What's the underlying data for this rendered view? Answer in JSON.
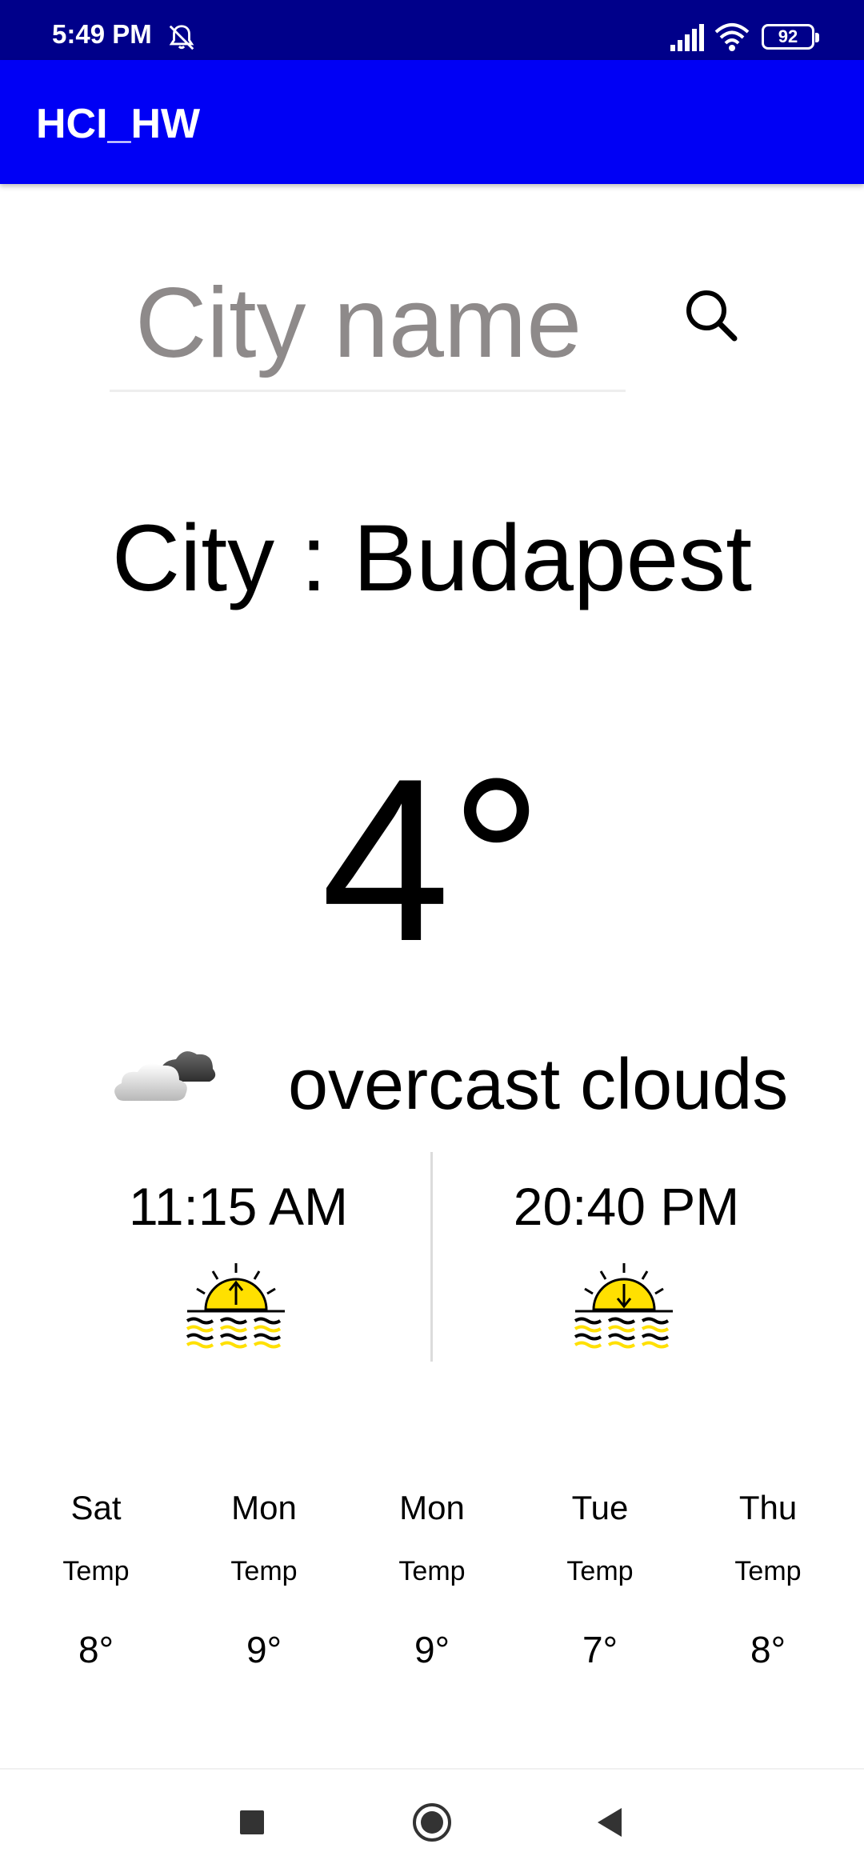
{
  "status_bar": {
    "time": "5:49 PM",
    "battery": "92",
    "bell_icon": "bell-muted-icon",
    "signal_icon": "signal-icon",
    "wifi_icon": "wifi-icon"
  },
  "app_bar": {
    "title": "HCI_HW",
    "color": "#0000f5"
  },
  "search": {
    "placeholder": "City name",
    "value": "",
    "icon": "search-icon"
  },
  "city": {
    "label": "City : Budapest"
  },
  "current": {
    "temperature": "4°",
    "description": "overcast clouds",
    "icon": "cloud-icon"
  },
  "sun": {
    "sunrise_time": "11:15 AM",
    "sunset_time": "20:40 PM",
    "sunrise_icon": "sunrise-icon",
    "sunset_icon": "sunset-icon",
    "sun_color": "#ffe000"
  },
  "forecast": [
    {
      "day": "Sat",
      "label": "Temp",
      "temp": "8°"
    },
    {
      "day": "Mon",
      "label": "Temp",
      "temp": "9°"
    },
    {
      "day": "Mon",
      "label": "Temp",
      "temp": "9°"
    },
    {
      "day": "Tue",
      "label": "Temp",
      "temp": "7°"
    },
    {
      "day": "Thu",
      "label": "Temp",
      "temp": "8°"
    }
  ],
  "nav": {
    "recents_icon": "recents-square-icon",
    "home_icon": "home-circle-icon",
    "back_icon": "back-triangle-icon"
  }
}
